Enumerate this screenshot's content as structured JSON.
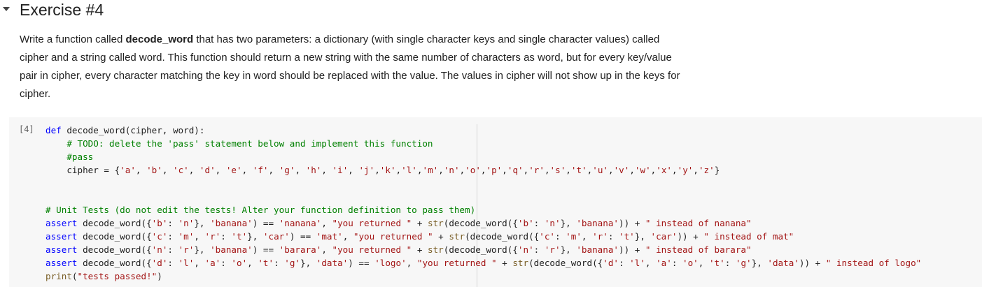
{
  "section": {
    "title": "Exercise #4"
  },
  "text": {
    "p1": "Write a function called ",
    "bold": "decode_word",
    "p2": " that has two parameters: a dictionary (with single character keys and single character values) called",
    "line2": "cipher and a string called word. This function should return a new string with the same number of characters as word, but for every key/value",
    "line3": "pair in cipher, every character matching the key in word should be replaced with the value. The values in cipher will not show up in the keys for",
    "line4": "cipher."
  },
  "cell": {
    "execution_count": "[4]",
    "lines": [
      "def decode_word(cipher, word):",
      "    # TODO: delete the 'pass' statement below and implement this function",
      "    #pass",
      "    cipher = {'a', 'b', 'c', 'd', 'e', 'f', 'g', 'h', 'i', 'j','k','l','m','n','o','p','q','r','s','t','u','v','w','x','y','z'}",
      "",
      "",
      "# Unit Tests (do not edit the tests! Alter your function definition to pass them)",
      "assert decode_word({'b': 'n'}, 'banana') == 'nanana', \"you returned \" + str(decode_word({'b': 'n'}, 'banana')) + \" instead of nanana\"",
      "assert decode_word({'c': 'm', 'r': 't'}, 'car') == 'mat', \"you returned \" + str(decode_word({'c': 'm', 'r': 't'}, 'car')) + \" instead of mat\"",
      "assert decode_word({'n': 'r'}, 'banana') == 'barara', \"you returned \" + str(decode_word({'n': 'r'}, 'banana')) + \" instead of barara\"",
      "assert decode_word({'d': 'l', 'a': 'o', 't': 'g'}, 'data') == 'logo', \"you returned \" + str(decode_word({'d': 'l', 'a': 'o', 't': 'g'}, 'data')) + \" instead of logo\"",
      "print(\"tests passed!\")"
    ]
  },
  "colors": {
    "keyword": "#0000ff",
    "string": "#a31515",
    "comment": "#008000",
    "cell_background": "#f7f7f7"
  },
  "icons": {
    "section_toggle": "caret-down-icon"
  }
}
